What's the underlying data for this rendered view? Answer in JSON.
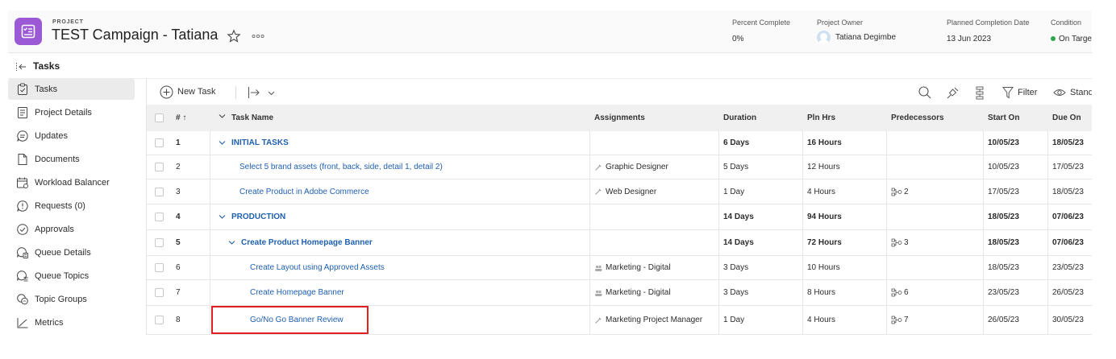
{
  "header": {
    "kicker": "PROJECT",
    "title": "TEST Campaign - Tatiana",
    "percent_complete_label": "Percent Complete",
    "percent_complete_value": "0%",
    "owner_label": "Project Owner",
    "owner_value": "Tatiana Degimbe",
    "planned_completion_label": "Planned Completion Date",
    "planned_completion_value": "13 Jun 2023",
    "condition_label": "Condition",
    "condition_value": "On Targe",
    "condition_color": "#2aa74a"
  },
  "section": {
    "title": "Tasks"
  },
  "sidebar": {
    "items": [
      {
        "label": "Tasks",
        "icon": "tasks-icon",
        "active": true
      },
      {
        "label": "Project Details",
        "icon": "document-icon"
      },
      {
        "label": "Updates",
        "icon": "chat-icon"
      },
      {
        "label": "Documents",
        "icon": "file-icon"
      },
      {
        "label": "Workload Balancer",
        "icon": "calendar-icon"
      },
      {
        "label": "Requests (0)",
        "icon": "request-icon"
      },
      {
        "label": "Approvals",
        "icon": "check-circle-icon"
      },
      {
        "label": "Queue Details",
        "icon": "queue-icon"
      },
      {
        "label": "Queue Topics",
        "icon": "queue-topics-icon"
      },
      {
        "label": "Topic Groups",
        "icon": "topic-groups-icon"
      },
      {
        "label": "Metrics",
        "icon": "chart-icon"
      }
    ]
  },
  "toolbar": {
    "new_task_label": "New Task",
    "filter_label": "Filter",
    "view_label": "Standarc"
  },
  "table": {
    "headers": {
      "num": "# ↑",
      "name": "Task Name",
      "assignments": "Assignments",
      "duration": "Duration",
      "pln_hrs": "Pln Hrs",
      "predecessors": "Predecessors",
      "start_on": "Start On",
      "due_on": "Due On"
    },
    "rows": [
      {
        "num": "1",
        "name": "INITIAL TASKS",
        "assignment": "",
        "duration": "6 Days",
        "pln_hrs": "16 Hours",
        "predecessor": "",
        "start": "10/05/23",
        "due": "18/05/23"
      },
      {
        "num": "2",
        "name": "Select 5 brand assets (front, back, side, detail 1, detail 2)",
        "assignment": "Graphic Designer",
        "duration": "5 Days",
        "pln_hrs": "12 Hours",
        "predecessor": "",
        "start": "10/05/23",
        "due": "17/05/23"
      },
      {
        "num": "3",
        "name": "Create Product in Adobe Commerce",
        "assignment": "Web Designer",
        "duration": "1 Day",
        "pln_hrs": "4 Hours",
        "predecessor": "2",
        "start": "17/05/23",
        "due": "18/05/23"
      },
      {
        "num": "4",
        "name": "PRODUCTION",
        "assignment": "",
        "duration": "14 Days",
        "pln_hrs": "94 Hours",
        "predecessor": "",
        "start": "18/05/23",
        "due": "07/06/23"
      },
      {
        "num": "5",
        "name": "Create Product Homepage Banner",
        "assignment": "",
        "duration": "14 Days",
        "pln_hrs": "72 Hours",
        "predecessor": "3",
        "start": "18/05/23",
        "due": "07/06/23"
      },
      {
        "num": "6",
        "name": "Create Layout using Approved Assets",
        "assignment": "Marketing - Digital",
        "duration": "3 Days",
        "pln_hrs": "10 Hours",
        "predecessor": "",
        "start": "18/05/23",
        "due": "23/05/23"
      },
      {
        "num": "7",
        "name": "Create Homepage Banner",
        "assignment": "Marketing - Digital",
        "duration": "3 Days",
        "pln_hrs": "8 Hours",
        "predecessor": "6",
        "start": "23/05/23",
        "due": "26/05/23"
      },
      {
        "num": "8",
        "name": "Go/No Go Banner Review",
        "assignment": "Marketing Project Manager",
        "duration": "1 Day",
        "pln_hrs": "4 Hours",
        "predecessor": "7",
        "start": "26/05/23",
        "due": "30/05/23"
      }
    ]
  },
  "colors": {
    "project_icon": "#9b59d6",
    "task_link": "#1f5fb0",
    "highlight_box": "#e02020"
  }
}
